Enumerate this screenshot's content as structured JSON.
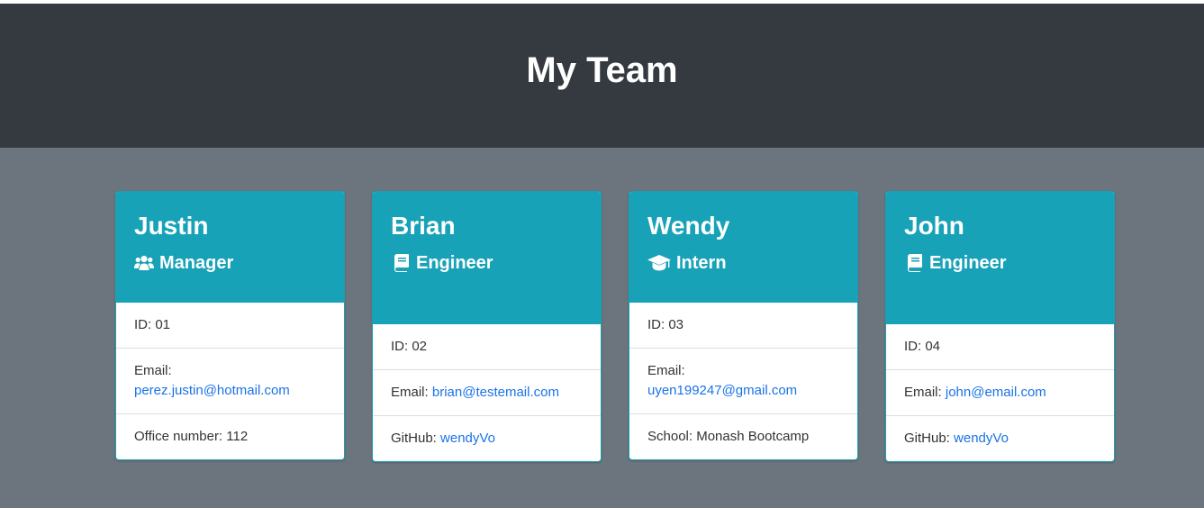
{
  "header": {
    "title": "My Team"
  },
  "colors": {
    "header_bg": "#343a40",
    "page_bg": "#6c757d",
    "card_head_bg": "#17a2b8",
    "link": "#1a73e8"
  },
  "cards": [
    {
      "name": "Justin",
      "role": "Manager",
      "role_icon": "users-icon",
      "id_text": "ID: 01",
      "email_label": "Email:",
      "email": "perez.justin@hotmail.com",
      "extra_label": "Office number: 112",
      "extra_link": ""
    },
    {
      "name": "Brian",
      "role": "Engineer",
      "role_icon": "book-icon",
      "id_text": "ID: 02",
      "email_label": "Email:",
      "email": "brian@testemail.com",
      "extra_label": "GitHub:",
      "extra_link": "wendyVo"
    },
    {
      "name": "Wendy",
      "role": "Intern",
      "role_icon": "graduation-cap-icon",
      "id_text": "ID: 03",
      "email_label": "Email:",
      "email": "uyen199247@gmail.com",
      "extra_label": "School: Monash Bootcamp",
      "extra_link": ""
    },
    {
      "name": "John",
      "role": "Engineer",
      "role_icon": "book-icon",
      "id_text": "ID: 04",
      "email_label": "Email:",
      "email": "john@email.com",
      "extra_label": "GitHub:",
      "extra_link": "wendyVo"
    }
  ]
}
